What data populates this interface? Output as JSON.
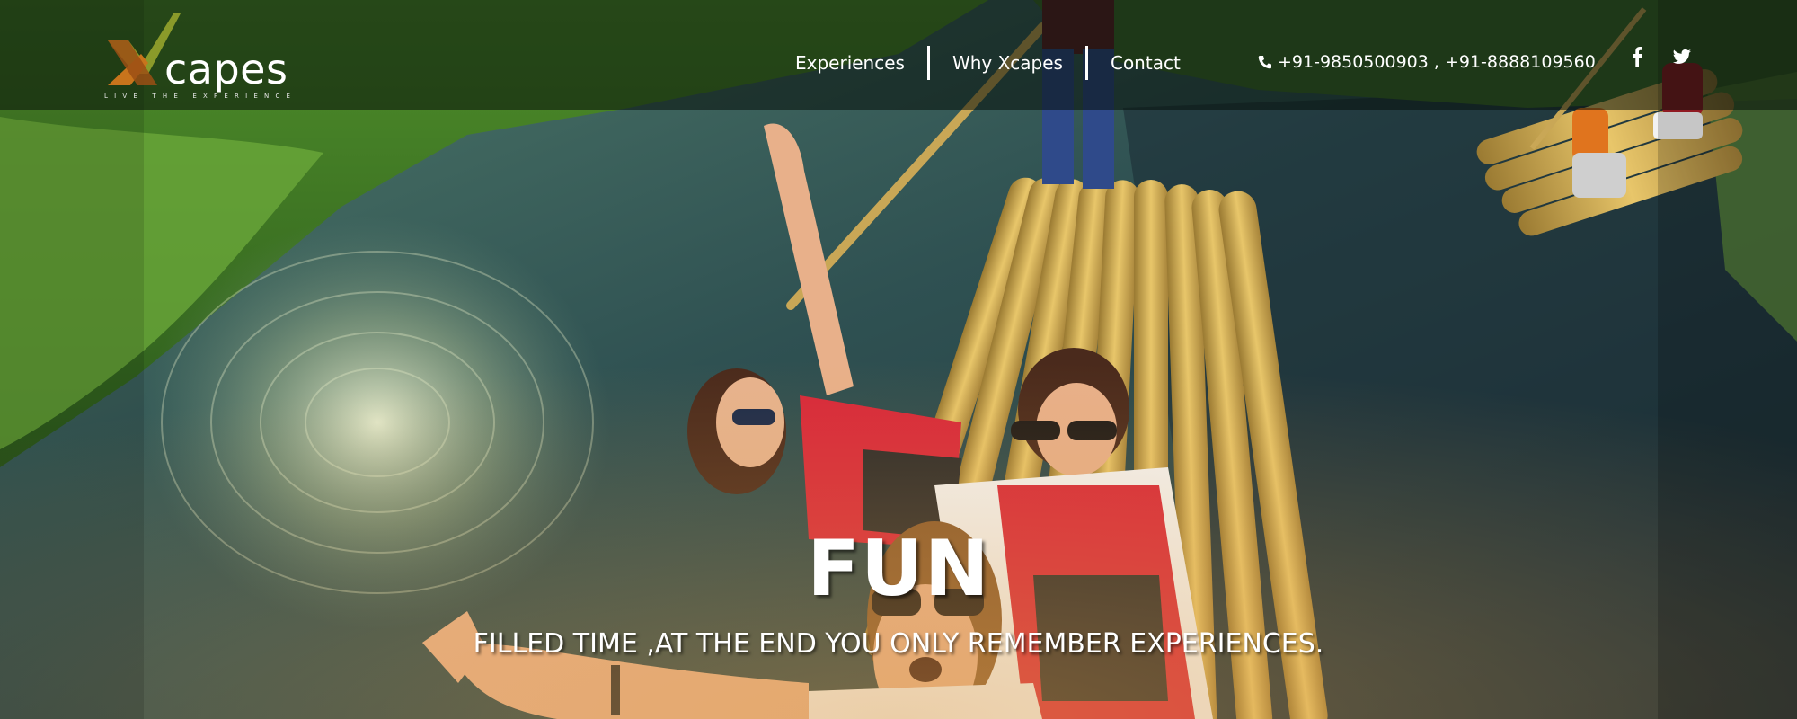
{
  "brand": {
    "name": "capes",
    "initial": "X",
    "tagline": "LIVE THE EXPERIENCE"
  },
  "nav": {
    "items": [
      {
        "label": "Experiences"
      },
      {
        "label": "Why Xcapes"
      },
      {
        "label": "Contact"
      }
    ]
  },
  "contact": {
    "phone_icon": "phone-icon",
    "phones": "+91-9850500903 , +91-8888109560"
  },
  "social": {
    "facebook_icon": "facebook-icon",
    "twitter_icon": "twitter-icon"
  },
  "hero": {
    "headline": "FUN",
    "subline": "FILLED TIME ,AT THE END YOU ONLY REMEMBER EXPERIENCES."
  },
  "colors": {
    "logo_green": "#8a9a2a",
    "logo_orange": "#c8741c",
    "header_overlay": "#0a120e",
    "text": "#ffffff"
  }
}
